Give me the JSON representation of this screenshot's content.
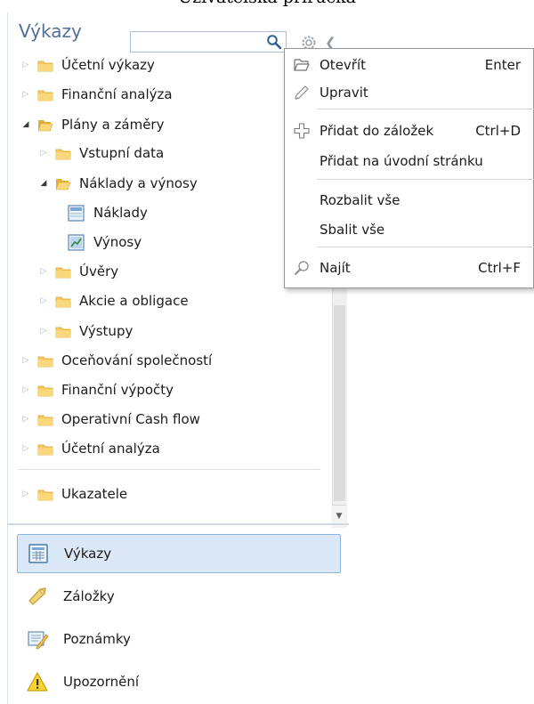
{
  "caption": "Uživatelská příručka",
  "header": {
    "title": "Výkazy",
    "search_value": ""
  },
  "tree": [
    {
      "label": "Účetní výkazy",
      "expanded": false
    },
    {
      "label": "Finanční analýza",
      "expanded": false
    },
    {
      "label": "Plány a záměry",
      "expanded": true
    },
    {
      "label": "Vstupní data",
      "expanded": false
    },
    {
      "label": "Náklady a výnosy",
      "expanded": true
    },
    {
      "label": "Náklady"
    },
    {
      "label": "Výnosy"
    },
    {
      "label": "Úvěry",
      "expanded": false
    },
    {
      "label": "Akcie a obligace",
      "expanded": false
    },
    {
      "label": "Výstupy",
      "expanded": false
    },
    {
      "label": "Oceňování společností",
      "expanded": false
    },
    {
      "label": "Finanční výpočty",
      "expanded": false
    },
    {
      "label": "Operativní Cash flow",
      "expanded": false
    },
    {
      "label": "Účetní analýza",
      "expanded": false
    },
    {
      "label": "Ukazatele",
      "expanded": false
    }
  ],
  "nav": [
    {
      "label": "Výkazy",
      "active": true
    },
    {
      "label": "Záložky",
      "active": false
    },
    {
      "label": "Poznámky",
      "active": false
    },
    {
      "label": "Upozornění",
      "active": false
    }
  ],
  "menu": [
    {
      "label": "Otevřít",
      "shortcut": "Enter",
      "icon": "open-folder-icon"
    },
    {
      "label": "Upravit",
      "shortcut": "",
      "icon": "pencil-icon"
    },
    {
      "label": "Přidat do záložek",
      "shortcut": "Ctrl+D",
      "icon": "add-bookmark-icon"
    },
    {
      "label": "Přidat na úvodní stránku",
      "shortcut": "",
      "icon": ""
    },
    {
      "label": "Rozbalit vše",
      "shortcut": "",
      "icon": ""
    },
    {
      "label": "Sbalit vše",
      "shortcut": "",
      "icon": ""
    },
    {
      "label": "Najít",
      "shortcut": "Ctrl+F",
      "icon": "find-icon"
    }
  ],
  "colors": {
    "title": "#4f7099",
    "folder": "#f5c95c",
    "active_nav_bg": "#dae8f7",
    "active_nav_border": "#8eb5dc"
  }
}
